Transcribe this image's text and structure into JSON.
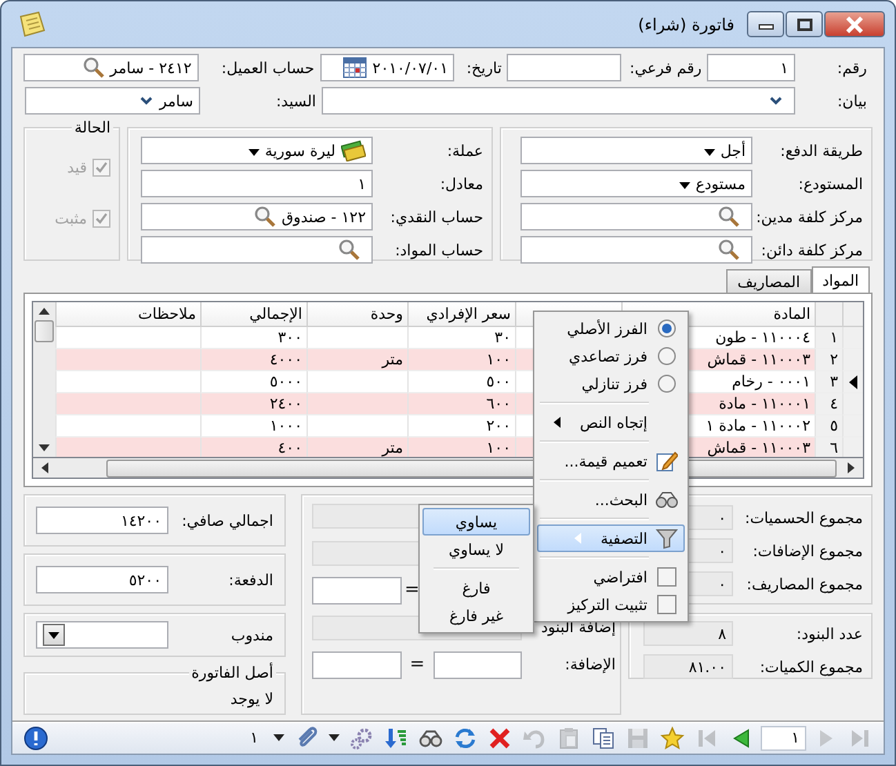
{
  "window": {
    "title": "فاتورة (شراء)"
  },
  "header_row1": [
    {
      "label": "رقم:",
      "kind": "text",
      "value": "١"
    },
    {
      "label": "رقم فرعي:",
      "kind": "text"
    },
    {
      "label": "تاريخ:",
      "kind": "date",
      "value": "٢٠١٠/٠٧/٠١"
    },
    {
      "label": "حساب العميل:",
      "kind": "lookup",
      "value": "٢٤١٢ - سامر"
    }
  ],
  "header_row2": [
    {
      "label": "بيان:",
      "kind": "combo"
    },
    {
      "label": "السيد:",
      "kind": "combo",
      "value": "سامر"
    }
  ],
  "payment_panel": [
    {
      "label": "طريقة الدفع:",
      "kind": "dropdown",
      "value": "أجل"
    },
    {
      "label": "المستودع:",
      "kind": "dropdown",
      "value": "مستودع"
    },
    {
      "label": "مركز كلفة مدين:",
      "kind": "lookup"
    },
    {
      "label": "مركز كلفة دائن:",
      "kind": "lookup"
    }
  ],
  "currency_panel": [
    {
      "label": "عملة:",
      "kind": "currency",
      "value": "ليرة سورية"
    },
    {
      "label": "معادل:",
      "kind": "text",
      "value": "١"
    },
    {
      "label": "حساب النقدي:",
      "kind": "lookup",
      "value": "١٢٢ - صندوق"
    },
    {
      "label": "حساب المواد:",
      "kind": "lookup"
    }
  ],
  "status": {
    "title": "الحالة",
    "checks": [
      {
        "label": "قيد",
        "checked": true,
        "disabled": true
      },
      {
        "label": "مثبت",
        "checked": true,
        "disabled": true
      }
    ]
  },
  "tabs": [
    {
      "label": "المواد",
      "selected": true
    },
    {
      "label": "المصاريف",
      "selected": false
    }
  ],
  "table": {
    "columns": [
      "المادة",
      "سعر الإفرادي",
      "وحدة",
      "الإجمالي",
      "ملاحظات"
    ],
    "rows": [
      {
        "number": "١",
        "material": "١١٠٠٠٤ - طون",
        "price": "٣٠",
        "total": "٣٠٠",
        "current": false
      },
      {
        "number": "٢",
        "material": "١١٠٠٠٣ - قماش",
        "price": "١٠٠",
        "unit": "متر",
        "total": "٤٠٠٠",
        "current": false
      },
      {
        "number": "٣",
        "material": "٠٠٠١ - رخام",
        "price": "٥٠٠",
        "total": "٥٠٠٠",
        "current": true
      },
      {
        "number": "٤",
        "material": "١١٠٠٠١ - مادة",
        "price": "٦٠٠",
        "total": "٢٤٠٠",
        "current": false
      },
      {
        "number": "٥",
        "material": "١١٠٠٠٢ - مادة ١",
        "price": "٢٠٠",
        "total": "١٠٠٠",
        "current": false
      },
      {
        "number": "٦",
        "material": "١١٠٠٠٣ - قماش",
        "price": "١٠٠",
        "unit": "متر",
        "total": "٤٠٠",
        "current": false
      }
    ]
  },
  "totals": [
    {
      "label": "مجموع الحسميات:",
      "value": "٠"
    },
    {
      "label": "مجموع الإضافات:",
      "value": "٠"
    },
    {
      "label": "مجموع المصاريف:",
      "value": "٠"
    }
  ],
  "counts": [
    {
      "label": "عدد البنود:",
      "value": "٨"
    },
    {
      "label": "مجموع الكميات:",
      "value": "٨١.٠٠"
    }
  ],
  "additions": {
    "items_label": "إضافة البنود",
    "addition_label": "الإضافة:",
    "equals": [
      "=",
      "="
    ]
  },
  "net_total": {
    "label": "اجمالي صافي:",
    "value": "١٤٢٠٠"
  },
  "payment": {
    "label": "الدفعة:",
    "value": "٥٢٠٠"
  },
  "agent": {
    "label": "مندوب"
  },
  "origin": {
    "title": "أصل الفاتورة",
    "value": "لا يوجد"
  },
  "toolbar": [
    {
      "kind": "last",
      "disabled": true
    },
    {
      "kind": "next",
      "disabled": true
    },
    {
      "kind": "page",
      "value": "١"
    },
    {
      "kind": "previous",
      "disabled": false
    },
    {
      "kind": "first",
      "disabled": true
    },
    {
      "kind": "favorite",
      "disabled": false
    },
    {
      "kind": "save",
      "disabled": true
    },
    {
      "kind": "copy",
      "disabled": false
    },
    {
      "kind": "paste",
      "disabled": true
    },
    {
      "kind": "undo",
      "disabled": true
    },
    {
      "kind": "delete",
      "disabled": false
    },
    {
      "kind": "refresh",
      "disabled": false
    },
    {
      "kind": "find",
      "disabled": false
    },
    {
      "kind": "sort",
      "disabled": false
    },
    {
      "kind": "settings",
      "disabled": false
    },
    {
      "kind": "dropdown"
    },
    {
      "kind": "attach",
      "disabled": false
    },
    {
      "kind": "dropdown"
    },
    {
      "kind": "count",
      "value": "١"
    }
  ],
  "context_menu": [
    {
      "kind": "radio",
      "label": "الفرز الأصلي",
      "selected": true,
      "highlighted": false
    },
    {
      "kind": "radio",
      "label": "فرز تصاعدي",
      "selected": false,
      "highlighted": false
    },
    {
      "kind": "radio",
      "label": "فرز تنازلي",
      "selected": false,
      "highlighted": false
    },
    {
      "kind": "separator"
    },
    {
      "kind": "submenu",
      "label": "إتجاه النص",
      "highlighted": false
    },
    {
      "kind": "separator"
    },
    {
      "kind": "edit",
      "label": "تعميم قيمة...",
      "highlighted": false
    },
    {
      "kind": "separator"
    },
    {
      "kind": "find",
      "label": "البحث...",
      "highlighted": false
    },
    {
      "kind": "separator"
    },
    {
      "kind": "filter",
      "label": "التصفية",
      "highlighted": true
    },
    {
      "kind": "separator"
    },
    {
      "kind": "check",
      "label": "افتراضي",
      "checked": false,
      "highlighted": false
    },
    {
      "kind": "check",
      "label": "تثبيت التركيز",
      "checked": false,
      "highlighted": false
    }
  ],
  "filter_submenu": [
    {
      "kind": "item",
      "label": "يساوي",
      "highlighted": true
    },
    {
      "kind": "item",
      "label": "لا يساوي",
      "highlighted": false
    },
    {
      "kind": "separator"
    },
    {
      "kind": "item",
      "label": "فارغ",
      "highlighted": false
    },
    {
      "kind": "item",
      "label": "غير فارغ",
      "highlighted": false
    }
  ]
}
